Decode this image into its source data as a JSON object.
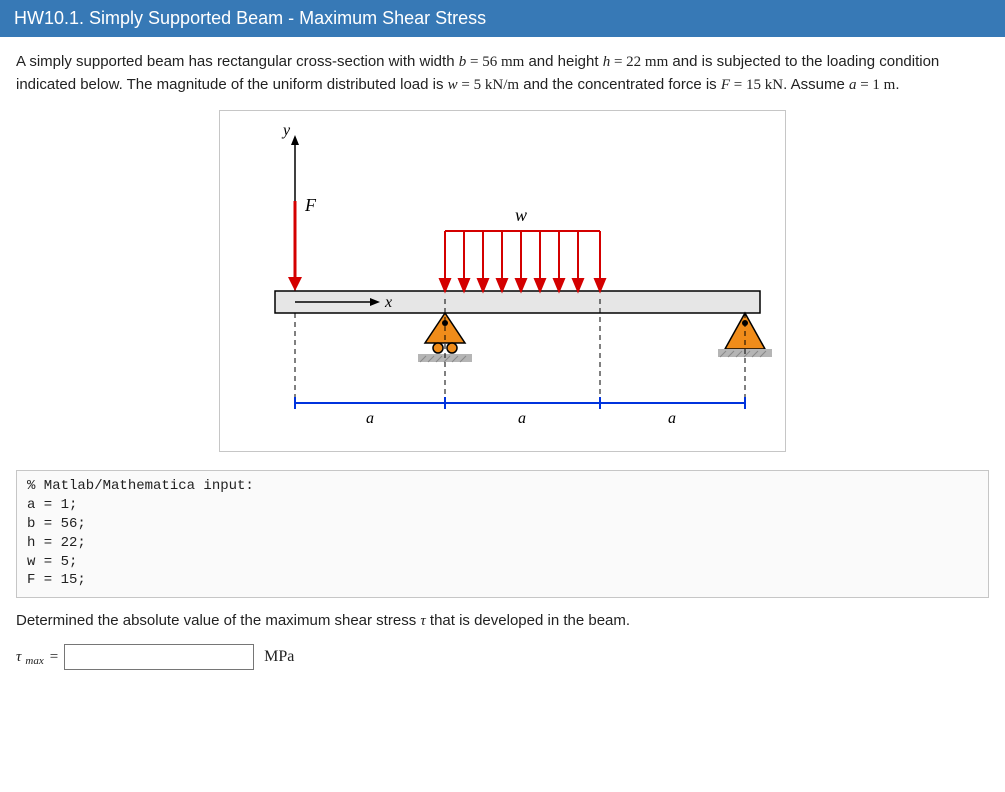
{
  "header": {
    "title": "HW10.1. Simply Supported Beam - Maximum Shear Stress"
  },
  "problem": {
    "pre_b": "A simply supported beam has rectangular cross-section with width ",
    "b_var": "b",
    "eq": " = ",
    "b_val": "56 mm",
    "mid1": " and height ",
    "h_var": "h",
    "h_val": "22 mm",
    "mid2": " and is subjected to the loading condition indicated below. The magnitude of the uniform distributed load is ",
    "w_var": "w",
    "w_val": "5 kN/m",
    "mid3": " and the concentrated force is ",
    "F_var": "F",
    "F_val": "15 kN",
    "mid4": ". Assume ",
    "a_var": "a",
    "a_val": "1 m",
    "end": "."
  },
  "diagram": {
    "y": "y",
    "x": "x",
    "F": "F",
    "w": "w",
    "a": "a"
  },
  "code": {
    "l1": "% Matlab/Mathematica input:",
    "l2": "a = 1;",
    "l3": "b = 56;",
    "l4": "h = 22;",
    "l5": "w = 5;",
    "l6": "F = 15;"
  },
  "prompt": {
    "pre": "Determined the absolute value of the maximum shear stress ",
    "tau": "τ",
    "post": " that is developed in the beam."
  },
  "answer": {
    "tau": "τ",
    "sub": "max",
    "eq": "=",
    "unit": "MPa",
    "value": ""
  }
}
